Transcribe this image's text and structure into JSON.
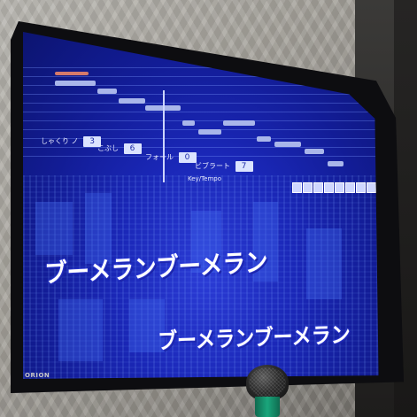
{
  "screen": {
    "parameters": [
      {
        "label": "しゃくり ノ",
        "value": "3"
      },
      {
        "label": "こぶし",
        "value": "6"
      },
      {
        "label": "フォール",
        "value": "0"
      },
      {
        "label": "ビブラート",
        "value": "7"
      }
    ],
    "key_label": "Key/Tempo",
    "lyrics": {
      "line1": "ブーメランブーメラン",
      "line2": "ブーメランブーメラン"
    }
  },
  "tv": {
    "brand": "ORION"
  },
  "colors": {
    "screen_blue": "#1a27b7",
    "lyric_text": "#ffffff",
    "note_bar": "#a9b6ea",
    "mic_handle": "#1aa67c"
  }
}
